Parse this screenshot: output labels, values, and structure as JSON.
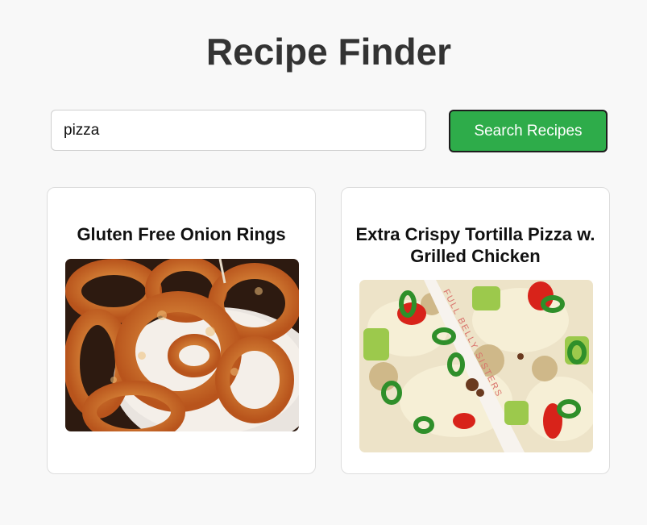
{
  "header": {
    "title": "Recipe Finder"
  },
  "search": {
    "value": "pizza",
    "button_label": "Search Recipes"
  },
  "results": [
    {
      "title": "Gluten Free Onion Rings",
      "image_subject": "onion-rings-photo"
    },
    {
      "title": "Extra Crispy Tortilla Pizza w. Grilled Chicken",
      "image_subject": "tortilla-pizza-photo",
      "image_watermark": "FULL BELLY SISTERS"
    }
  ],
  "colors": {
    "background": "#f8f8f8",
    "accent": "#2eac4a",
    "title": "#333333"
  }
}
